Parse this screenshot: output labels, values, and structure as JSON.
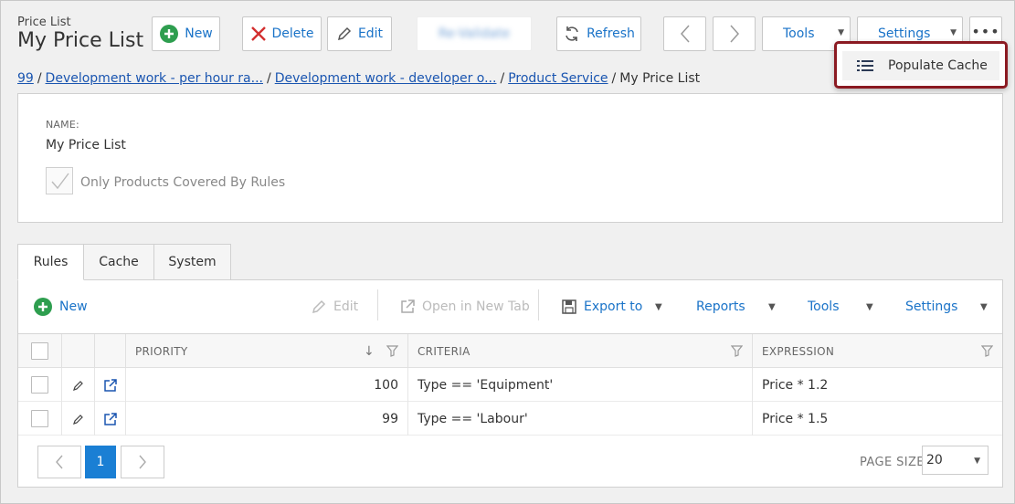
{
  "header": {
    "caption": "Price List",
    "title": "My Price List"
  },
  "toolbar": {
    "new_label": "New",
    "delete_label": "Delete",
    "edit_label": "Edit",
    "blurred_label": "Re-Validate",
    "refresh_label": "Refresh",
    "tools_label": "Tools",
    "settings_label": "Settings"
  },
  "breadcrumb": {
    "items": [
      "99",
      "Development work - per hour ra...",
      "Development work - developer o...",
      "Product Service"
    ],
    "current": "My Price List",
    "separator": "/"
  },
  "form": {
    "name_label": "NAME:",
    "name_value": "My Price List",
    "checkbox_label": "Only Products Covered By Rules",
    "checkbox_checked": true
  },
  "tabs": [
    {
      "label": "Rules",
      "active": true
    },
    {
      "label": "Cache",
      "active": false
    },
    {
      "label": "System",
      "active": false
    }
  ],
  "grid_toolbar": {
    "new_label": "New",
    "edit_label": "Edit",
    "open_label": "Open in New Tab",
    "export_label": "Export to",
    "reports_label": "Reports",
    "tools_label": "Tools",
    "settings_label": "Settings"
  },
  "table": {
    "columns": [
      "PRIORITY",
      "CRITERIA",
      "EXPRESSION"
    ],
    "rows": [
      {
        "priority": "100",
        "criteria": "Type == 'Equipment'",
        "expression": "Price * 1.2"
      },
      {
        "priority": "99",
        "criteria": "Type == 'Labour'",
        "expression": "Price * 1.5"
      }
    ]
  },
  "pager": {
    "current_page": "1",
    "page_size_label": "PAGE SIZE",
    "page_size": "20"
  },
  "popup_menu": {
    "item_label": "Populate Cache"
  },
  "colors": {
    "accent": "#1a73c8",
    "new_green": "#2e9e4f",
    "delete_red": "#d32f2f",
    "popup_border": "#8b1a22"
  }
}
